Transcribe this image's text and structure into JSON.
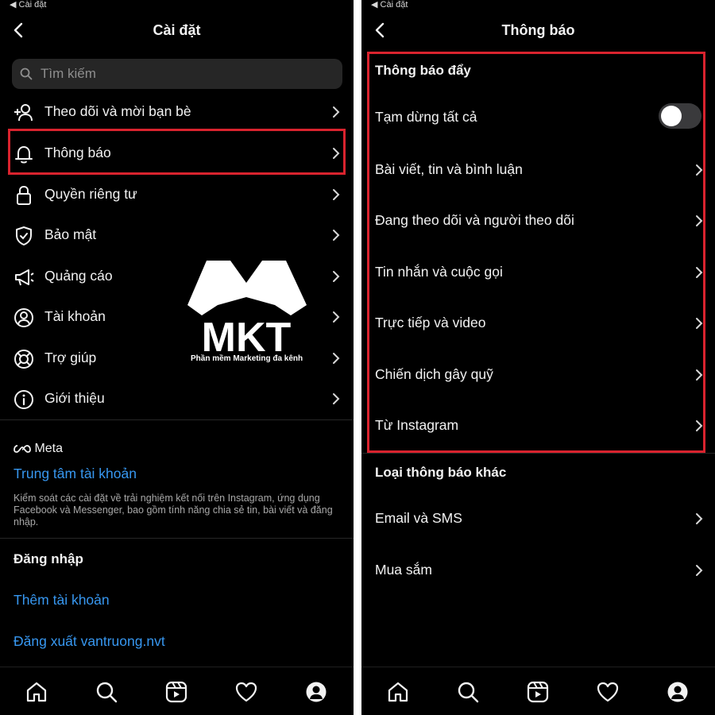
{
  "left": {
    "status_back": "◀ Cài đặt",
    "title": "Cài đặt",
    "search_placeholder": "Tìm kiếm",
    "menu": [
      {
        "label": "Theo dõi và mời bạn bè",
        "icon": "add-person-icon"
      },
      {
        "label": "Thông báo",
        "icon": "bell-icon",
        "highlighted": true
      },
      {
        "label": "Quyền riêng tư",
        "icon": "lock-icon"
      },
      {
        "label": "Bảo mật",
        "icon": "shield-icon"
      },
      {
        "label": "Quảng cáo",
        "icon": "megaphone-icon"
      },
      {
        "label": "Tài khoản",
        "icon": "account-icon"
      },
      {
        "label": "Trợ giúp",
        "icon": "lifebuoy-icon"
      },
      {
        "label": "Giới thiệu",
        "icon": "info-icon"
      }
    ],
    "meta_logo": "Meta",
    "accounts_center": "Trung tâm tài khoản",
    "accounts_center_desc": "Kiểm soát các cài đặt về trải nghiệm kết nối trên Instagram, ứng dụng Facebook và Messenger, bao gồm tính năng chia sẻ tin, bài viết và đăng nhập.",
    "login_section": "Đăng nhập",
    "add_account": "Thêm tài khoản",
    "logout": "Đăng xuất vantruong.nvt"
  },
  "right": {
    "status_back": "◀ Cài đặt",
    "title": "Thông báo",
    "push_section": "Thông báo đẩy",
    "pause_all": "Tạm dừng tất cả",
    "pause_all_enabled": false,
    "push_items": [
      "Bài viết, tin và bình luận",
      "Đang theo dõi và người theo dõi",
      "Tin nhắn và cuộc gọi",
      "Trực tiếp và video",
      "Chiến dịch gây quỹ",
      "Từ Instagram"
    ],
    "other_section": "Loại thông báo khác",
    "other_items": [
      "Email và SMS",
      "Mua sắm"
    ]
  },
  "navbar": [
    "home-icon",
    "search-icon",
    "reels-icon",
    "heart-icon",
    "profile-icon"
  ],
  "watermark": {
    "logo_text": "MKT",
    "tagline": "Phần mềm Marketing đa kênh"
  },
  "colors": {
    "background": "#000000",
    "text": "#f2f2f2",
    "link": "#3797f0",
    "highlight": "#d9232e",
    "muted": "#8e8e8e"
  }
}
